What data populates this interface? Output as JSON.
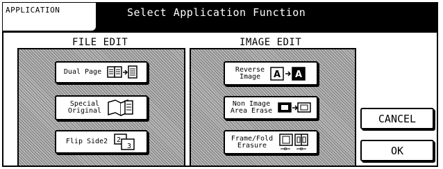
{
  "header": {
    "tab_label": "APPLICATION",
    "title": "Select Application Function"
  },
  "file_edit": {
    "title": "FILE EDIT",
    "buttons": {
      "dual_page": "Dual Page",
      "special_original": "Special\nOriginal",
      "flip_side2": "Flip Side2"
    }
  },
  "image_edit": {
    "title": "IMAGE EDIT",
    "buttons": {
      "reverse_image": "Reverse\nImage",
      "non_image_erase": "Non Image\nArea Erase",
      "frame_fold": "Frame/Fold\nErasure"
    }
  },
  "actions": {
    "cancel": "CANCEL",
    "ok": "OK"
  },
  "icons": {
    "dual_page": "book-to-page-icon",
    "special_original": "open-book-icon",
    "flip_side2": "two-sided-flip-icon",
    "reverse_image": "reverse-a-icon",
    "non_image_erase": "area-erase-icon",
    "frame_fold": "frame-fold-icon"
  }
}
